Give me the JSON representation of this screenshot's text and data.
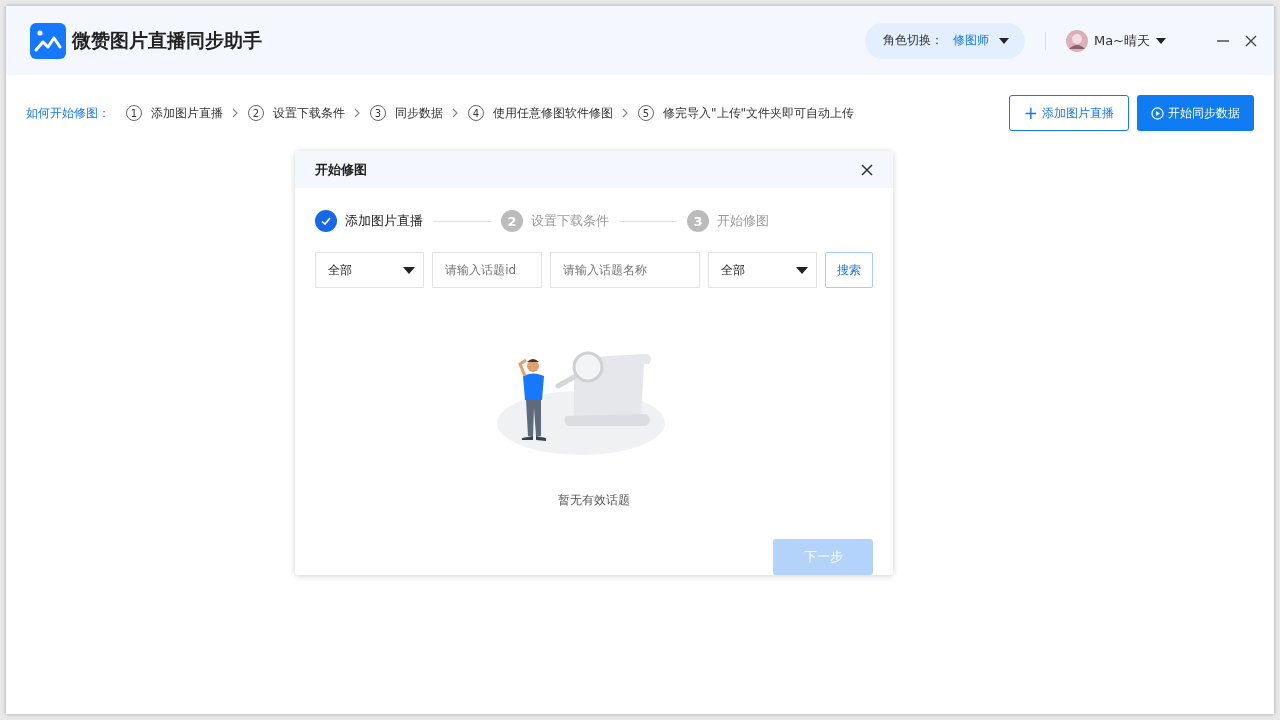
{
  "window": {
    "title": "微赞图片直播同步助手",
    "role_switch": {
      "label": "角色切换：",
      "value": "修图师"
    },
    "user": {
      "name": "Ma~晴天"
    }
  },
  "guide": {
    "label": "如何开始修图：",
    "steps": [
      {
        "number": "1",
        "text": "添加图片直播"
      },
      {
        "number": "2",
        "text": "设置下载条件"
      },
      {
        "number": "3",
        "text": "同步数据"
      },
      {
        "number": "4",
        "text": "使用任意修图软件修图"
      },
      {
        "number": "5",
        "text": "修完导入\"上传\"文件夹即可自动上传"
      }
    ]
  },
  "actions": [
    {
      "kind": "outline",
      "icon": "+",
      "label": "添加图片直播"
    },
    {
      "kind": "primary",
      "label": "开始同步数据"
    }
  ],
  "dialog": {
    "title": "开始修图",
    "steps": [
      {
        "label": "添加图片直播",
        "done": true
      },
      {
        "number": "2",
        "label": "设置下载条件",
        "done": false
      },
      {
        "number": "3",
        "label": "开始修图",
        "done": false
      }
    ],
    "filters": [
      {
        "kind": "select",
        "value": "全部"
      },
      {
        "kind": "input",
        "placeholder": "请输入话题id"
      },
      {
        "kind": "input",
        "placeholder": "请输入话题名称"
      },
      {
        "kind": "select",
        "value": "全部"
      }
    ],
    "search_button": "搜索",
    "empty_text": "暂无有效话题",
    "next_button": {
      "label": "下一步",
      "disabled": true
    }
  }
}
